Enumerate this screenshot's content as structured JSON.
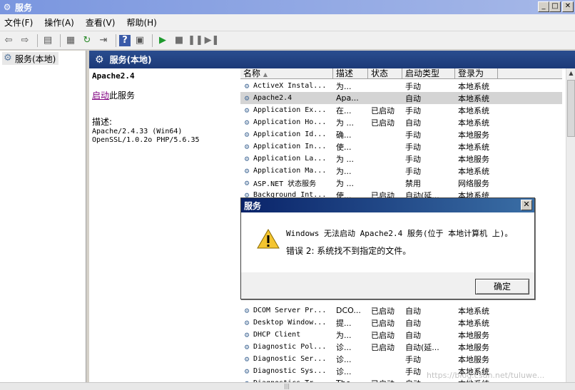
{
  "window": {
    "title": "服务"
  },
  "menu": [
    "文件(F)",
    "操作(A)",
    "查看(V)",
    "帮助(H)"
  ],
  "tree": {
    "item": "服务(本地)"
  },
  "content": {
    "header": "服务(本地)"
  },
  "details": {
    "service_name": "Apache2.4",
    "start_link": "启动",
    "start_suffix": "此服务",
    "desc_label": "描述:",
    "desc_text": "Apache/2.4.33 (Win64)\nOpenSSL/1.0.2o PHP/5.6.35"
  },
  "columns": [
    "名称",
    "描述",
    "状态",
    "启动类型",
    "登录为"
  ],
  "rows": [
    {
      "name": "ActiveX Instal...",
      "desc": "为...",
      "status": "",
      "startup": "手动",
      "logon": "本地系统"
    },
    {
      "name": "Apache2.4",
      "desc": "Apa...",
      "status": "",
      "startup": "自动",
      "logon": "本地系统"
    },
    {
      "name": "Application Ex...",
      "desc": "在...",
      "status": "已启动",
      "startup": "手动",
      "logon": "本地系统"
    },
    {
      "name": "Application Ho...",
      "desc": "为 ...",
      "status": "已启动",
      "startup": "自动",
      "logon": "本地系统"
    },
    {
      "name": "Application Id...",
      "desc": "确...",
      "status": "",
      "startup": "手动",
      "logon": "本地服务"
    },
    {
      "name": "Application In...",
      "desc": "使...",
      "status": "",
      "startup": "手动",
      "logon": "本地系统"
    },
    {
      "name": "Application La...",
      "desc": "为 ...",
      "status": "",
      "startup": "手动",
      "logon": "本地服务"
    },
    {
      "name": "Application Ma...",
      "desc": "为...",
      "status": "",
      "startup": "手动",
      "logon": "本地系统"
    },
    {
      "name": "ASP.NET 状态服务",
      "desc": "为 ...",
      "status": "",
      "startup": "禁用",
      "logon": "网络服务"
    },
    {
      "name": "Background Int...",
      "desc": "使...",
      "status": "已启动",
      "startup": "自动(延...",
      "logon": "本地系统"
    }
  ],
  "rows_bottom": [
    {
      "name": "DCOM Server Pr...",
      "desc": "DCO...",
      "status": "已启动",
      "startup": "自动",
      "logon": "本地系统"
    },
    {
      "name": "Desktop Window...",
      "desc": "提...",
      "status": "已启动",
      "startup": "自动",
      "logon": "本地系统"
    },
    {
      "name": "DHCP Client",
      "desc": "为...",
      "status": "已启动",
      "startup": "自动",
      "logon": "本地服务"
    },
    {
      "name": "Diagnostic Pol...",
      "desc": "诊...",
      "status": "已启动",
      "startup": "自动(延...",
      "logon": "本地服务"
    },
    {
      "name": "Diagnostic Ser...",
      "desc": "诊...",
      "status": "",
      "startup": "手动",
      "logon": "本地服务"
    },
    {
      "name": "Diagnostic Sys...",
      "desc": "诊...",
      "status": "",
      "startup": "手动",
      "logon": "本地系统"
    },
    {
      "name": "Diagnostics Tr...",
      "desc": "The...",
      "status": "已启动",
      "startup": "自动",
      "logon": "本地系统"
    }
  ],
  "dialog": {
    "title": "服务",
    "message1": "Windows 无法启动 Apache2.4 服务(位于 本地计算机 上)。",
    "message2": "错误 2: 系统找不到指定的文件。",
    "ok": "确定"
  },
  "watermark": "https://blog.csdn.net/tuluwe..."
}
